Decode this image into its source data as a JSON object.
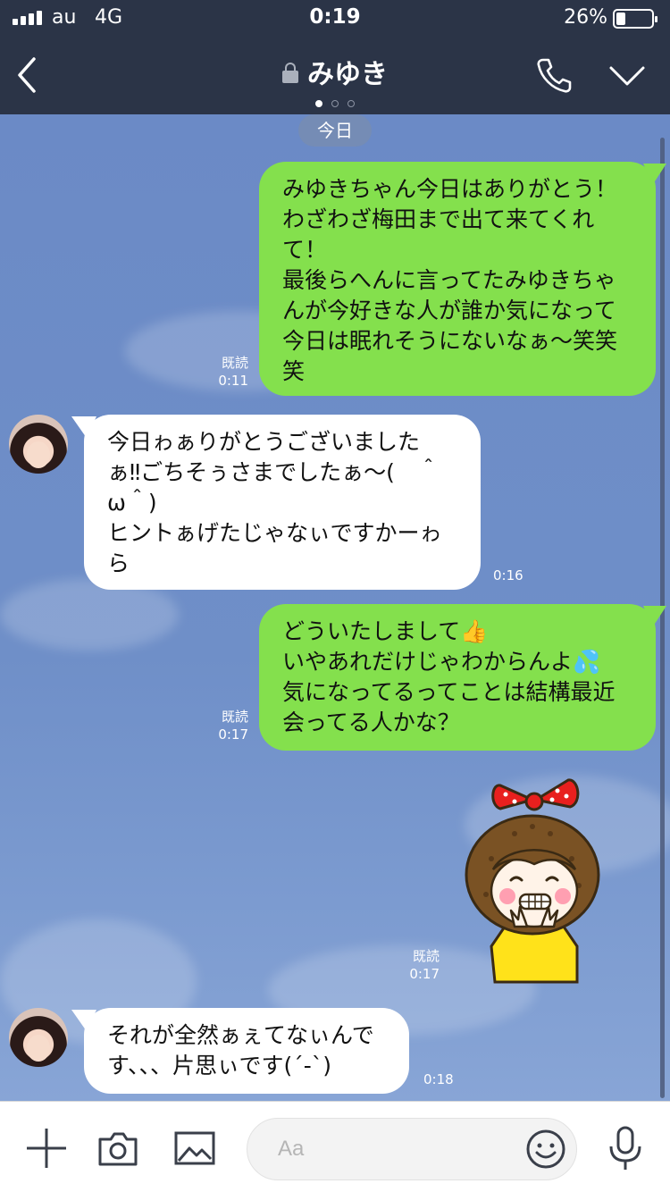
{
  "status_bar": {
    "carrier": "au",
    "network": "4G",
    "time": "0:19",
    "battery_percent": "26%",
    "battery_level": 0.26
  },
  "header": {
    "title": "みゆき",
    "page_indicator": {
      "count": 3,
      "active": 0
    }
  },
  "chat": {
    "date_label": "今日",
    "messages": [
      {
        "side": "me",
        "text": "みゆきちゃん今日はありがとう！\nわざわざ梅田まで出て来てくれ\nて！\n最後らへんに言ってたみゆきちゃ\nんが今好きな人が誰か気になって\n今日は眠れそうにないなぁ〜笑笑\n笑",
        "read": "既読",
        "time": "0:11"
      },
      {
        "side": "them",
        "text": "今日ゎぁりがとうございました\nぁ‼︎ごちそぅさまでしたぁ〜(　＾\nω＾)\nヒントぁげたじゃなぃですかーゎ\nら",
        "time": "0:16"
      },
      {
        "side": "me",
        "text": "どういたしまして👍\nいやあれだけじゃわからんよ💦\n気になってるってことは結構最近\n会ってる人かな？",
        "read": "既読",
        "time": "0:17"
      },
      {
        "side": "me",
        "type": "sticker",
        "sticker": "girl-with-red-bow-sticker",
        "read": "既読",
        "time": "0:17"
      },
      {
        "side": "them",
        "text": "それが全然ぁぇてなぃんで\nす、、、片思ぃです(´-`)",
        "time": "0:18"
      }
    ]
  },
  "input_bar": {
    "placeholder": "Aa",
    "icons": [
      "plus-icon",
      "camera-icon",
      "image-icon",
      "emoji-icon",
      "microphone-icon"
    ]
  },
  "colors": {
    "header_bg": "#2b3447",
    "chat_bg": "#6b8ac6",
    "my_bubble": "#84e04d",
    "their_bubble": "#ffffff"
  }
}
